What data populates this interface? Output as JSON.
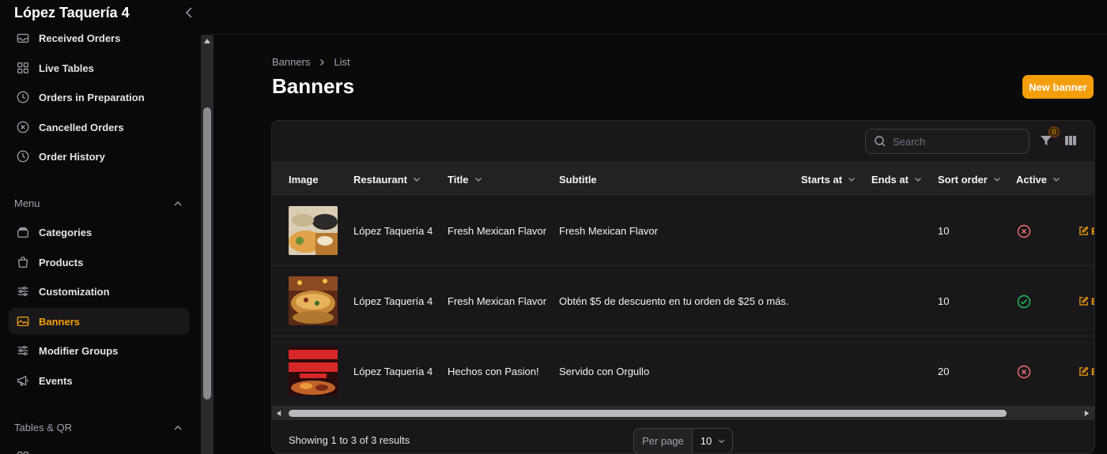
{
  "app": {
    "brand": "López Taquería 4"
  },
  "sidebar": {
    "items": [
      {
        "label": "Received Orders",
        "icon": "inbox-icon"
      },
      {
        "label": "Live Tables",
        "icon": "grid-icon"
      },
      {
        "label": "Orders in Preparation",
        "icon": "clock-icon"
      },
      {
        "label": "Cancelled Orders",
        "icon": "x-circle-icon"
      },
      {
        "label": "Order History",
        "icon": "clock-icon"
      }
    ],
    "groups": [
      {
        "label": "Menu",
        "items": [
          {
            "label": "Categories",
            "icon": "stack-icon"
          },
          {
            "label": "Products",
            "icon": "shopping-bag-icon"
          },
          {
            "label": "Customization",
            "icon": "sliders-icon"
          },
          {
            "label": "Banners",
            "icon": "image-icon",
            "active": true
          },
          {
            "label": "Modifier Groups",
            "icon": "sliders-icon"
          },
          {
            "label": "Events",
            "icon": "megaphone-icon"
          }
        ]
      },
      {
        "label": "Tables & QR"
      }
    ]
  },
  "breadcrumb": {
    "parent": "Banners",
    "current": "List"
  },
  "page": {
    "title": "Banners",
    "new_button": "New banner"
  },
  "toolbar": {
    "search_placeholder": "Search",
    "filter_count": "0"
  },
  "table": {
    "columns": {
      "image": "Image",
      "restaurant": "Restaurant",
      "title": "Title",
      "subtitle": "Subtitle",
      "starts_at": "Starts at",
      "ends_at": "Ends at",
      "sort_order": "Sort order",
      "active": "Active"
    },
    "rows": [
      {
        "restaurant": "López Taquería 4",
        "title": "Fresh Mexican Flavor",
        "subtitle": "Fresh Mexican Flavor",
        "starts_at": "",
        "ends_at": "",
        "sort_order": "10",
        "active": false,
        "edit": "E"
      },
      {
        "restaurant": "López Taquería 4",
        "title": "Fresh Mexican Flavor",
        "subtitle": "Obtén $5 de descuento en tu orden de $25 o más.",
        "starts_at": "",
        "ends_at": "",
        "sort_order": "10",
        "active": true,
        "edit": "E"
      },
      {
        "restaurant": "López Taquería 4",
        "title": "Hechos con Pasion!",
        "subtitle": "Servido con Orgullo",
        "starts_at": "",
        "ends_at": "",
        "sort_order": "20",
        "active": false,
        "edit": "E"
      }
    ]
  },
  "footer": {
    "showing": "Showing 1 to 3 of 3 results",
    "per_page_label": "Per page",
    "per_page_value": "10"
  },
  "colors": {
    "accent": "#f59e0b",
    "success": "#22c55e",
    "danger": "#f87171"
  }
}
